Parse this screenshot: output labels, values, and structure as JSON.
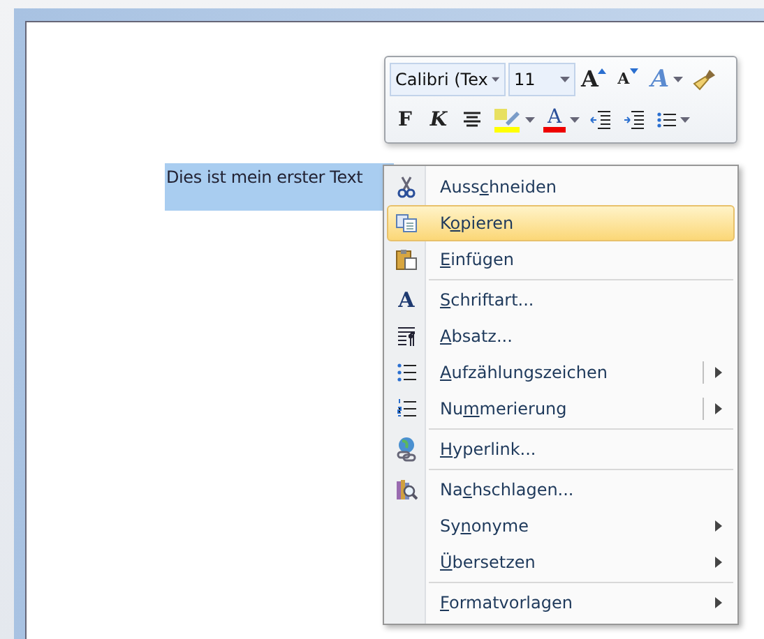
{
  "document": {
    "selected_text": "Dies ist mein erster Text"
  },
  "mini_toolbar": {
    "font": "Calibri (Tex",
    "size": "11",
    "row1": [
      {
        "kind": "grow",
        "glyph": "A"
      },
      {
        "kind": "shrink",
        "glyph": "A"
      },
      {
        "kind": "effects",
        "glyph": "A"
      },
      {
        "kind": "painter"
      }
    ],
    "row2": [
      {
        "kind": "bold",
        "glyph": "F"
      },
      {
        "kind": "italic",
        "glyph": "K"
      },
      {
        "kind": "center"
      },
      {
        "kind": "highlight"
      },
      {
        "kind": "fontcolor",
        "glyph": "A"
      },
      {
        "kind": "outdent"
      },
      {
        "kind": "indent"
      },
      {
        "kind": "bullets"
      }
    ]
  },
  "context_menu": [
    {
      "kind": "scissors",
      "pre": "Auss",
      "key": "c",
      "post": "hneiden",
      "selected": false,
      "submenu": false,
      "separator_after": false
    },
    {
      "kind": "copy",
      "pre": "K",
      "key": "o",
      "post": "pieren",
      "selected": true,
      "submenu": false,
      "separator_after": false
    },
    {
      "kind": "paste",
      "key": "E",
      "post": "infügen",
      "selected": false,
      "submenu": false,
      "separator_after": true
    },
    {
      "kind": "font",
      "glyph": "A",
      "key": "S",
      "post": "chriftart...",
      "selected": false,
      "submenu": false,
      "separator_after": false
    },
    {
      "kind": "paragraph",
      "key": "A",
      "post": "bsatz...",
      "selected": false,
      "submenu": false,
      "separator_after": false
    },
    {
      "kind": "bullets",
      "key": "A",
      "post": "ufzählungszeichen",
      "selected": false,
      "submenu": true,
      "split": true,
      "separator_after": false
    },
    {
      "kind": "numbering",
      "pre": "Nu",
      "key": "m",
      "post": "merierung",
      "selected": false,
      "submenu": true,
      "split": true,
      "separator_after": true
    },
    {
      "kind": "hyperlink",
      "key": "H",
      "post": "yperlink...",
      "selected": false,
      "submenu": false,
      "separator_after": true
    },
    {
      "kind": "research",
      "pre": "Na",
      "key": "c",
      "post": "hschlagen...",
      "selected": false,
      "submenu": false,
      "separator_after": false
    },
    {
      "kind": "plain",
      "pre": "Sy",
      "key": "n",
      "post": "onyme",
      "selected": false,
      "submenu": true,
      "split": false,
      "separator_after": false
    },
    {
      "kind": "plain",
      "key": "Ü",
      "post": "bersetzen",
      "selected": false,
      "submenu": true,
      "split": false,
      "separator_after": true
    },
    {
      "kind": "plain",
      "key": "F",
      "post": "ormatvorlagen",
      "selected": false,
      "submenu": true,
      "split": false,
      "separator_after": false
    }
  ]
}
